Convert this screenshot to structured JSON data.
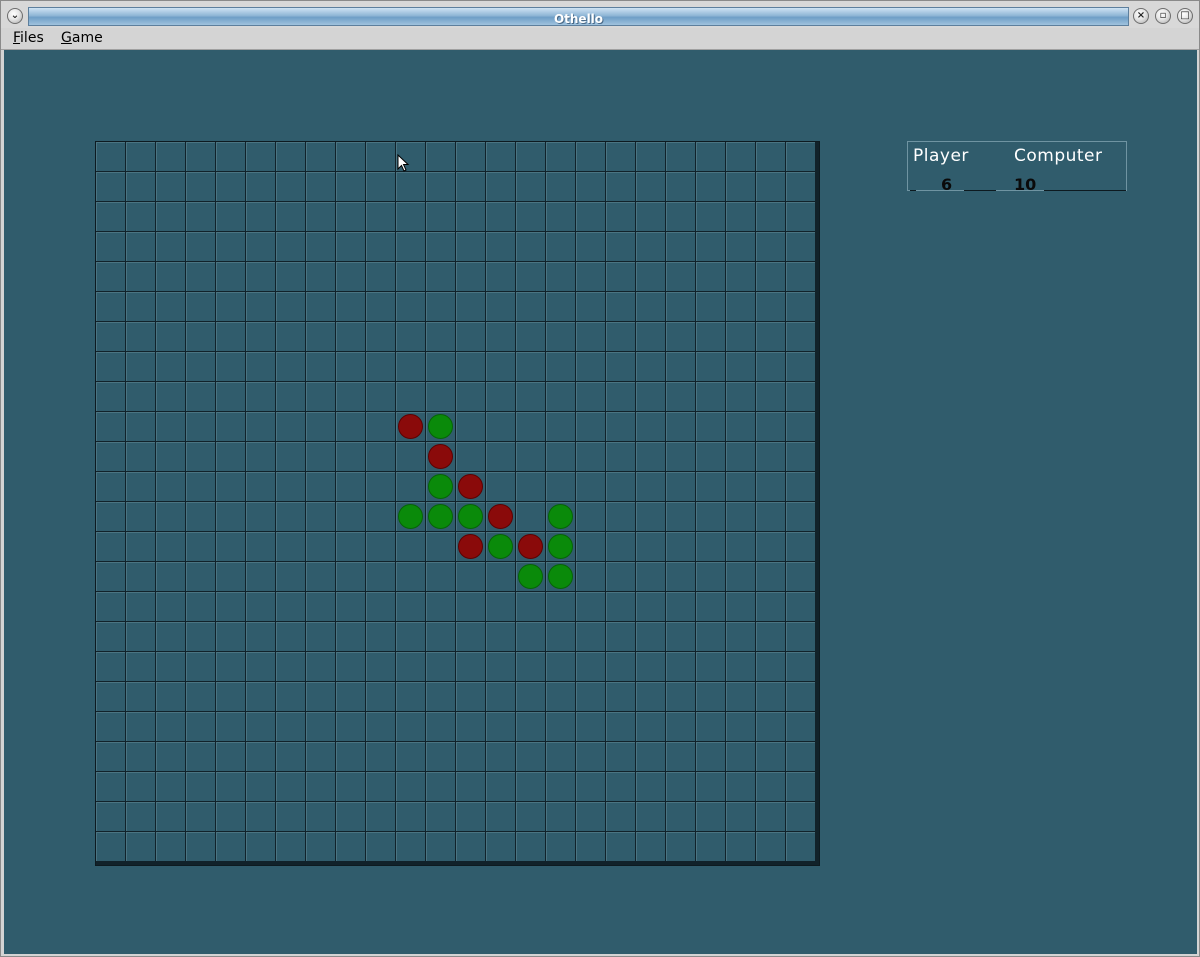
{
  "window": {
    "title": "Othello",
    "buttons": [
      "close-icon",
      "restore-icon",
      "maximize-icon",
      "menu-icon"
    ]
  },
  "menu": {
    "files_mnemonic": "F",
    "files_rest": "iles",
    "game_mnemonic": "G",
    "game_rest": "ame"
  },
  "colors": {
    "background": "#305c6c",
    "player_piece": "#8a0a0a",
    "computer_piece": "#0a8a0a",
    "grid_line": "#11222a"
  },
  "board": {
    "size": 24,
    "pieces": [
      {
        "row": 9,
        "col": 10,
        "color": "red"
      },
      {
        "row": 9,
        "col": 11,
        "color": "green"
      },
      {
        "row": 10,
        "col": 11,
        "color": "red"
      },
      {
        "row": 11,
        "col": 11,
        "color": "green"
      },
      {
        "row": 11,
        "col": 12,
        "color": "red"
      },
      {
        "row": 12,
        "col": 10,
        "color": "green"
      },
      {
        "row": 12,
        "col": 11,
        "color": "green"
      },
      {
        "row": 12,
        "col": 12,
        "color": "green"
      },
      {
        "row": 12,
        "col": 13,
        "color": "red"
      },
      {
        "row": 12,
        "col": 15,
        "color": "green"
      },
      {
        "row": 13,
        "col": 12,
        "color": "red"
      },
      {
        "row": 13,
        "col": 13,
        "color": "green"
      },
      {
        "row": 13,
        "col": 14,
        "color": "red"
      },
      {
        "row": 13,
        "col": 15,
        "color": "green"
      },
      {
        "row": 14,
        "col": 14,
        "color": "green"
      },
      {
        "row": 14,
        "col": 15,
        "color": "green"
      }
    ]
  },
  "score": {
    "player_label": "Player",
    "computer_label": "Computer",
    "player_value": "6",
    "computer_value": "10"
  }
}
